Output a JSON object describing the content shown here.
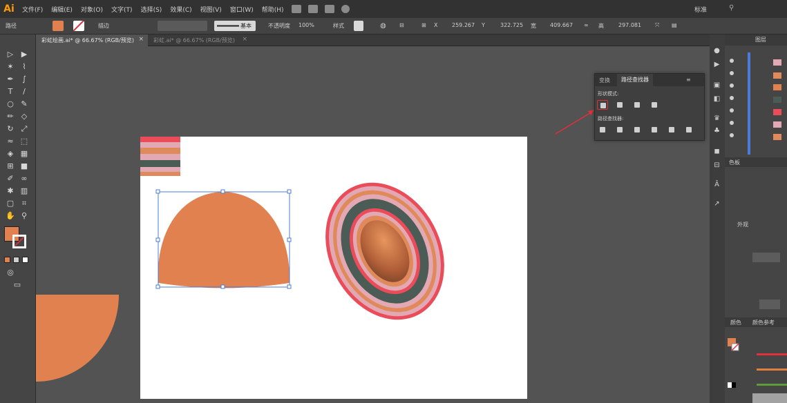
{
  "app": {
    "logo": "Ai"
  },
  "menu": {
    "items": [
      "文件(F)",
      "编辑(E)",
      "对象(O)",
      "文字(T)",
      "选择(S)",
      "效果(C)",
      "视图(V)",
      "窗口(W)",
      "帮助(H)"
    ],
    "workspace": "标准"
  },
  "control_bar": {
    "selection_label": "路径",
    "brush_label": "描边",
    "stroke_profile_label": "基本",
    "opacity_label": "不透明度",
    "opacity_value": "100%",
    "style_label": "样式",
    "x_label": "X",
    "x_value": "259.267",
    "y_label": "Y",
    "y_value": "322.725",
    "w_label": "宽",
    "w_value": "409.667",
    "h_label": "高",
    "h_value": "297.081",
    "fill_color": "#e0814f",
    "stroke_color": "none"
  },
  "tabs": [
    {
      "label": "彩虹绘画.ai* @ 66.67% (RGB/预览)",
      "active": true
    },
    {
      "label": "彩虹.ai* @ 66.67% (RGB/预览)",
      "active": false
    }
  ],
  "tab_close_glyph": "×",
  "toolbar": {
    "fill_swatch": "#e0814f",
    "tools": [
      "selection-icon",
      "direct-selection-icon",
      "magic-wand-icon",
      "lasso-icon",
      "pen-icon",
      "curvature-icon",
      "type-icon",
      "line-icon",
      "ellipse-icon",
      "paintbrush-icon",
      "pencil-icon",
      "eraser-icon",
      "rotate-icon",
      "scale-icon",
      "width-icon",
      "free-transform-icon",
      "shape-builder-icon",
      "perspective-icon",
      "mesh-icon",
      "gradient-icon",
      "eyedropper-icon",
      "blend-icon",
      "symbol-sprayer-icon",
      "column-graph-icon",
      "artboard-icon",
      "slice-icon",
      "hand-icon",
      "zoom-icon"
    ],
    "tool_glyphs": [
      "▷",
      "▶",
      "✶",
      "⌇",
      "✒",
      "∫",
      "T",
      "/",
      "○",
      "✎",
      "✏",
      "◇",
      "↻",
      "⤢",
      "≈",
      "⬚",
      "◈",
      "▦",
      "⊞",
      "■",
      "✐",
      "∞",
      "✱",
      "▥",
      "▢",
      "⌗",
      "✋",
      "⚲"
    ]
  },
  "pathfinder": {
    "tab_transform": "变换",
    "tab_pathfinder": "路径查找器",
    "shape_modes_label": "形状模式:",
    "pathfinders_label": "路径查找器:"
  },
  "right_panel": {
    "layers_label": "图层",
    "swatches_label": "色板",
    "appearance_label": "外观",
    "color_label": "颜色",
    "color_guide_label": "颜色参考"
  },
  "colors": {
    "shape_fill": "#e0814f",
    "stripe_red": "#ea4c5a",
    "stripe_pink": "#e2a9b4",
    "stripe_orange": "#e08a5c",
    "stripe_dark": "#4b5b55",
    "selection_blue": "#4b7bd6",
    "annotation_red": "#e0303a"
  }
}
